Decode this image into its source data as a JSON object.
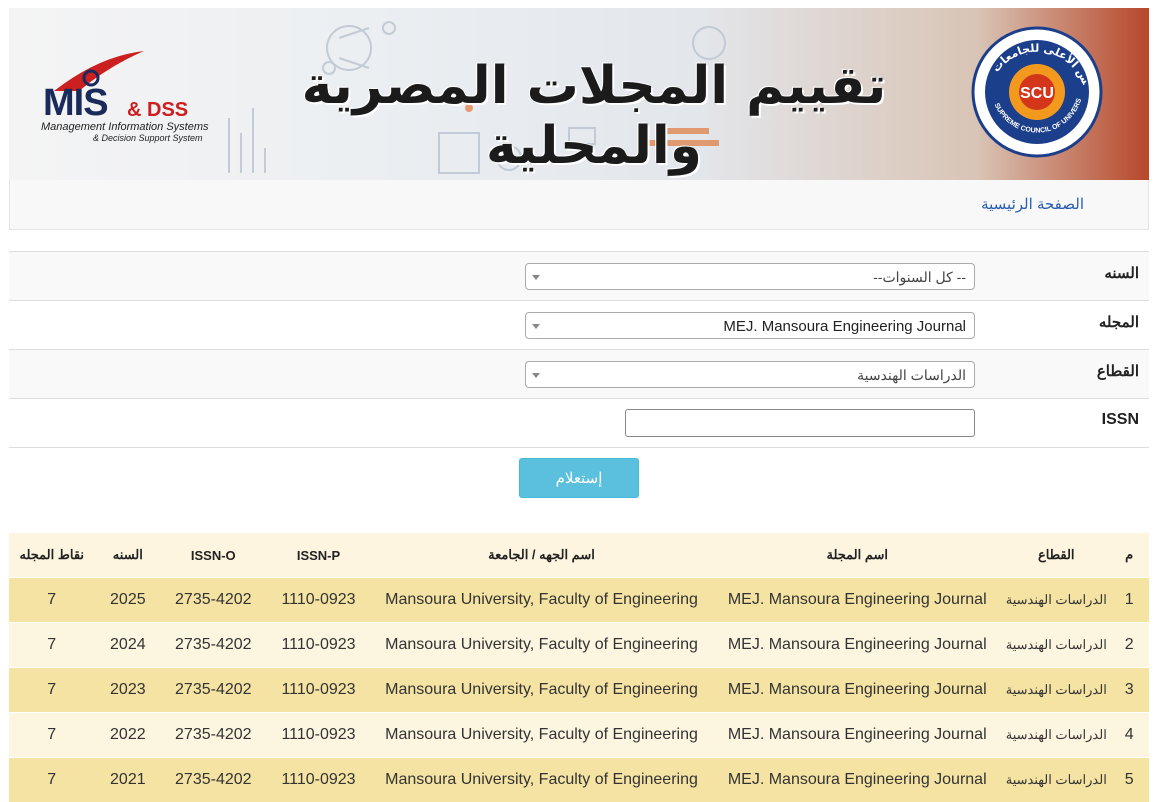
{
  "banner": {
    "title": "تقييم المجلات المصرية والمحلية",
    "mis_logo": {
      "main": "MIS",
      "suffix": "& DSS",
      "line1": "Management Information Systems",
      "line2": "& Decision Support System"
    },
    "seal": {
      "center": "SCU",
      "ring": "SUPREME COUNCIL OF UNIVERSITIES",
      "arabic": "المجلس الأعلى للجامعات"
    }
  },
  "nav": {
    "home_link": "الصفحة الرئيسية"
  },
  "form": {
    "year": {
      "label": "السنه",
      "value": "--كل السنوات --"
    },
    "journal": {
      "label": "المجله",
      "value": "MEJ. Mansoura Engineering Journal"
    },
    "sector": {
      "label": "القطاع",
      "value": "الدراسات الهندسية"
    },
    "issn": {
      "label": "ISSN",
      "value": ""
    },
    "submit_label": "إستعلام"
  },
  "table": {
    "headers": {
      "num": "م",
      "sector": "القطاع",
      "journal": "اسم المجلة",
      "institution": "اسم الجهه / الجامعة",
      "issn_p": "ISSN-P",
      "issn_o": "ISSN-O",
      "year": "السنه",
      "points": "نقاط المجله"
    },
    "rows": [
      {
        "num": "1",
        "sector": "الدراسات الهندسية",
        "journal": "MEJ. Mansoura Engineering Journal",
        "institution": "Mansoura University, Faculty of Engineering",
        "issn_p": "1110-0923",
        "issn_o": "2735-4202",
        "year": "2025",
        "points": "7"
      },
      {
        "num": "2",
        "sector": "الدراسات الهندسية",
        "journal": "MEJ. Mansoura Engineering Journal",
        "institution": "Mansoura University, Faculty of Engineering",
        "issn_p": "1110-0923",
        "issn_o": "2735-4202",
        "year": "2024",
        "points": "7"
      },
      {
        "num": "3",
        "sector": "الدراسات الهندسية",
        "journal": "MEJ. Mansoura Engineering Journal",
        "institution": "Mansoura University, Faculty of Engineering",
        "issn_p": "1110-0923",
        "issn_o": "2735-4202",
        "year": "2023",
        "points": "7"
      },
      {
        "num": "4",
        "sector": "الدراسات الهندسية",
        "journal": "MEJ. Mansoura Engineering Journal",
        "institution": "Mansoura University, Faculty of Engineering",
        "issn_p": "1110-0923",
        "issn_o": "2735-4202",
        "year": "2022",
        "points": "7"
      },
      {
        "num": "5",
        "sector": "الدراسات الهندسية",
        "journal": "MEJ. Mansoura Engineering Journal",
        "institution": "Mansoura University, Faculty of Engineering",
        "issn_p": "1110-0923",
        "issn_o": "2735-4202",
        "year": "2021",
        "points": "7"
      }
    ]
  }
}
